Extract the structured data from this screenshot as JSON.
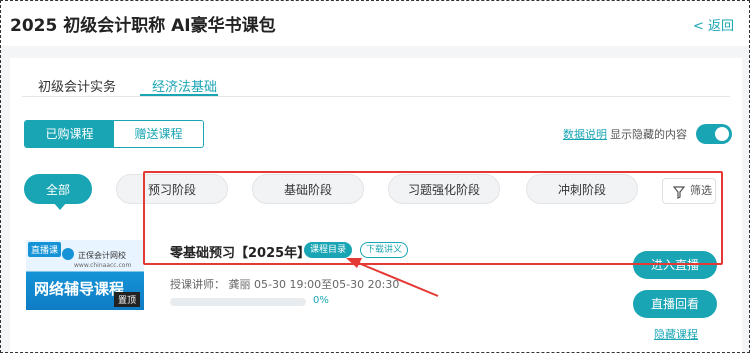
{
  "header": {
    "title": "2025 初级会计职称 AI豪华书课包",
    "back_label": "< 返回"
  },
  "subject_tabs": [
    {
      "label": "初级会计实务",
      "active": false
    },
    {
      "label": "经济法基础",
      "active": true
    }
  ],
  "segment": {
    "purchased_label": "已购课程",
    "gift_label": "赠送课程",
    "active": "purchased"
  },
  "options": {
    "data_link": "数据说明",
    "show_hidden_label": "显示隐藏的内容",
    "show_hidden_on": true
  },
  "stage_tabs": [
    {
      "label": "全部",
      "active": true
    },
    {
      "label": "预习阶段",
      "active": false
    },
    {
      "label": "基础阶段",
      "active": false
    },
    {
      "label": "习题强化阶段",
      "active": false
    },
    {
      "label": "冲刺阶段",
      "active": false
    }
  ],
  "filter": {
    "label": "筛选"
  },
  "course": {
    "thumb_badge": "直播课",
    "thumb_school": "正保会计网校",
    "thumb_url": "www.chinaacc.com",
    "thumb_title": "网络辅导课程",
    "pin_label": "置顶",
    "title": "零基础预习【2025年】",
    "catalog_tag": "课程目录",
    "download_tag": "下载讲义",
    "teacher_line": "授课讲师：  龚丽 05-30 19:00至05-30 20:30",
    "progress_text": "0%",
    "progress": 0,
    "enter_live_label": "进入直播",
    "replay_label": "直播回看",
    "hide_label": "隐藏课程"
  },
  "colors": {
    "accent": "#1aa5b4",
    "highlight": "#e53935"
  }
}
